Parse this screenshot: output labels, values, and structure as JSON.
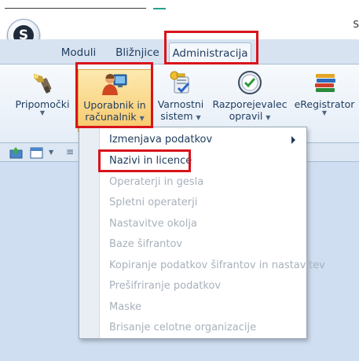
{
  "app": {
    "logo_letter": "S",
    "corner_letter": "S"
  },
  "tabs": [
    {
      "label": "Moduli"
    },
    {
      "label": "Bližnjice"
    },
    {
      "label": "Administracija"
    }
  ],
  "ribbon": {
    "pripomocki": "Pripomočki",
    "uporabnik_line1": "Uporabnik in",
    "uporabnik_line2": "računalnik",
    "varnostni_line1": "Varnostni",
    "varnostni_line2": "sistem",
    "razporejevalec_line1": "Razporejevalec",
    "razporejevalec_line2": "opravil",
    "eregistrator": "eRegistrator"
  },
  "menu": {
    "items": [
      {
        "label": "Izmenjava podatkov",
        "enabled": true,
        "submenu": true
      },
      {
        "label": "Nazivi in licence",
        "enabled": true
      },
      {
        "label": "Operaterji in gesla",
        "enabled": false
      },
      {
        "label": "Spletni operaterji",
        "enabled": false
      },
      {
        "label": "Nastavitve okolja",
        "enabled": false
      },
      {
        "label": "Baze šifrantov",
        "enabled": false
      },
      {
        "label": "Kopiranje podatkov šifrantov in nastavitev",
        "enabled": false
      },
      {
        "label": "Prešifriranje podatkov",
        "enabled": false
      },
      {
        "label": "Maske",
        "enabled": false
      },
      {
        "label": "Brisanje celotne organizacije",
        "enabled": false
      }
    ]
  },
  "colors": {
    "highlight": "#d8141c",
    "ribbon_text": "#1e3b5e",
    "disabled_text": "#a8b1bc",
    "workspace": "#cfdff1"
  }
}
